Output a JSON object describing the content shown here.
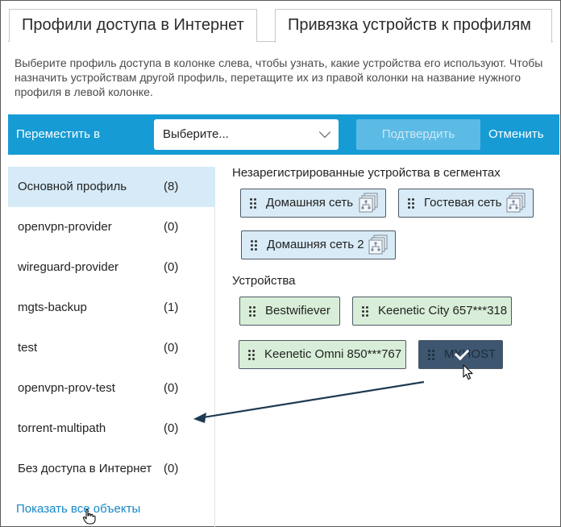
{
  "tabs": [
    {
      "label": "Профили доступа в Интернет",
      "active": false
    },
    {
      "label": "Привязка устройств к профилям",
      "active": true
    }
  ],
  "intro": "Выберите профиль доступа в колонке слева, чтобы узнать, какие устройства его используют. Чтобы назначить устройствам другой профиль, перетащите их из правой колонки на название нужного профиля в левой колонке.",
  "toolbar": {
    "move_label": "Переместить в",
    "select_value": "Выберите...",
    "confirm_label": "Подтвердить",
    "cancel_label": "Отменить",
    "accent": "#169bd5"
  },
  "profiles": [
    {
      "name": "Основной профиль",
      "count": "(8)",
      "selected": true
    },
    {
      "name": "openvpn-provider",
      "count": "(0)"
    },
    {
      "name": "wireguard-provider",
      "count": "(0)"
    },
    {
      "name": "mgts-backup",
      "count": "(1)"
    },
    {
      "name": "test",
      "count": "(0)"
    },
    {
      "name": "openvpn-prov-test",
      "count": "(0)"
    },
    {
      "name": "torrent-multipath",
      "count": "(0)"
    },
    {
      "name": "Без доступа в Интернет",
      "count": "(0)"
    }
  ],
  "show_all": "Показать все объекты",
  "segments": {
    "title": "Незарегистрированные устройства в сегментах",
    "items": [
      "Домашняя сеть",
      "Гостевая сеть",
      "Домашняя сеть 2"
    ]
  },
  "devices": {
    "title": "Устройства",
    "items": [
      "Bestwifiever",
      "Keenetic City 657***318",
      "Keenetic Omni 850***767",
      "MYHOST"
    ]
  }
}
